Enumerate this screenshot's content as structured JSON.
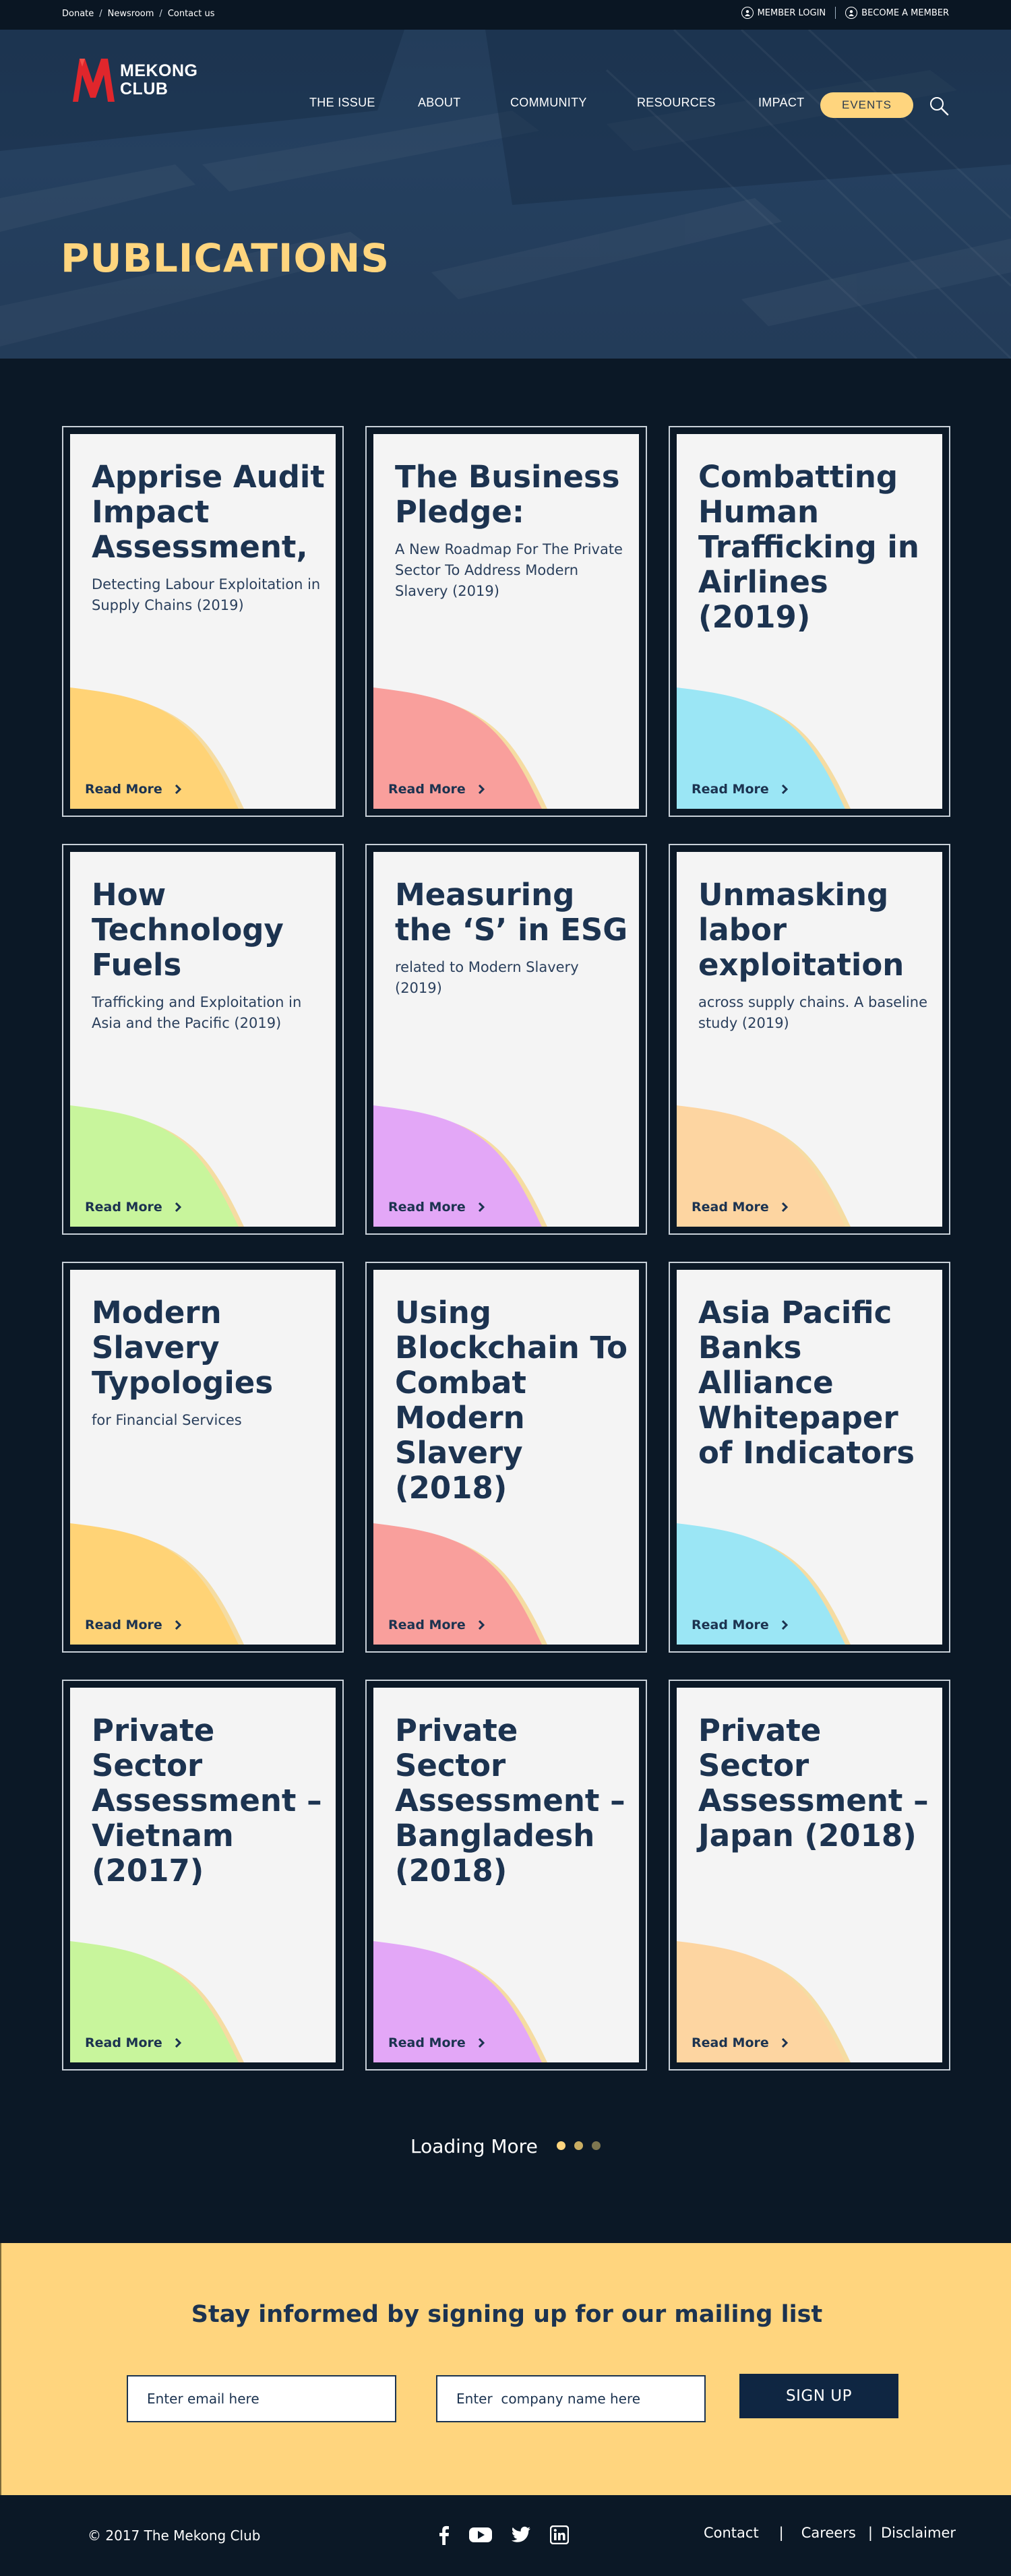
{
  "topbar": {
    "links": [
      "Donate",
      "Newsroom",
      "Contact us"
    ],
    "separator": "/",
    "member_login": "MEMBER  LOGIN",
    "become_member": "BECOME A MEMBER"
  },
  "brand": {
    "line1": "MEKONG",
    "line2": "CLUB",
    "color": "#e0262c"
  },
  "nav": {
    "items": [
      "THE ISSUE",
      "ABOUT",
      "COMMUNITY",
      "RESOURCES",
      "IMPACT"
    ],
    "events": "EVENTS"
  },
  "page_title": "PUBLICATIONS",
  "cards": [
    {
      "title": "Apprise Audit Impact Assessment,",
      "subtitle": "Detecting Labour Exploitation in Supply Chains (2019)",
      "color": "#ffd376",
      "read_more": "Read More"
    },
    {
      "title": "The Business Pledge:",
      "subtitle": "A New Roadmap For The Private Sector To Address Modern Slavery (2019)",
      "color": "#f99f9c",
      "read_more": "Read More"
    },
    {
      "title": "Combatting Human Trafficking in Airlines (2019)",
      "subtitle": "",
      "color": "#9be6f5",
      "read_more": "Read More"
    },
    {
      "title": "How Technology Fuels",
      "subtitle": "Trafficking and Exploitation in Asia and the Pacific (2019)",
      "color": "#c8f59c",
      "read_more": "Read More"
    },
    {
      "title": "Measuring the ‘S’ in ESG",
      "subtitle": " related to Modern Slavery (2019)",
      "color": "#e3a7f7",
      "read_more": "Read More"
    },
    {
      "title": "Unmasking labor exploitation",
      "subtitle": "across supply chains. A  baseline study (2019)",
      "color": "#fdd5a1",
      "read_more": "Read More"
    },
    {
      "title": "Modern Slavery Typologies",
      "subtitle": "for Financial Services",
      "color": "#ffd376",
      "read_more": "Read More"
    },
    {
      "title": "Using Blockchain To Combat Modern Slavery (2018)",
      "subtitle": "",
      "color": "#f99f9c",
      "read_more": "Read More"
    },
    {
      "title": "Asia Pacific Banks Alliance Whitepaper of Indicators",
      "subtitle": "",
      "color": "#9be6f5",
      "read_more": "Read More"
    },
    {
      "title": "Private Sector Assessment – Vietnam (2017)",
      "subtitle": "",
      "color": "#c8f59c",
      "read_more": "Read More"
    },
    {
      "title": "Private Sector Assessment – Bangladesh (2018)",
      "subtitle": "",
      "color": "#e3a7f7",
      "read_more": "Read More"
    },
    {
      "title": "Private Sector Assessment – Japan (2018)",
      "subtitle": "",
      "color": "#fdd5a1",
      "read_more": "Read More"
    }
  ],
  "loading": {
    "text": "Loading More",
    "dot_colors": [
      "#ffd57e",
      "#c9ad62",
      "#7d7650"
    ]
  },
  "mailing": {
    "heading": "Stay informed by signing up for our mailing list",
    "email_placeholder": "Enter email here",
    "company_placeholder": "Enter  company name here",
    "signup": "SIGN UP"
  },
  "footer": {
    "copyright": "© 2017 The Mekong Club",
    "social_icons": [
      "facebook-icon",
      "youtube-icon",
      "twitter-icon",
      "linkedin-icon"
    ],
    "links": [
      "Contact",
      "Careers",
      "Disclaimer"
    ],
    "separator": "|"
  }
}
